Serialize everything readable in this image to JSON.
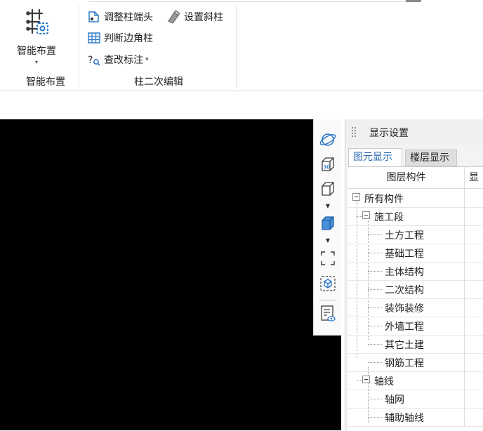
{
  "ribbon": {
    "smart_layout": {
      "label": "智能布置",
      "group_label": "智能布置"
    },
    "column_edit": {
      "adjust_column_end": "调整柱端头",
      "set_inclined_column": "设置斜柱",
      "judge_corner_column": "判断边角柱",
      "check_annotation": "查改标注",
      "group_label": "柱二次编辑"
    }
  },
  "view_toolbar": {
    "icons": [
      "orbit-icon",
      "3d-view-icon",
      "box-view-icon",
      "solid-box-icon",
      "full-screen-icon",
      "isometric-icon",
      "display-settings-icon"
    ]
  },
  "panel": {
    "title": "显示设置",
    "tabs": [
      {
        "label": "图元显示",
        "active": true
      },
      {
        "label": "楼层显示",
        "active": false
      }
    ],
    "columns": {
      "layer": "图层构件",
      "display": "显"
    },
    "rows": [
      {
        "label": "所有构件",
        "level": 0,
        "toggle": true
      },
      {
        "label": "施工段",
        "level": 1,
        "toggle": true
      },
      {
        "label": "土方工程",
        "level": 2,
        "toggle": false
      },
      {
        "label": "基础工程",
        "level": 2,
        "toggle": false
      },
      {
        "label": "主体结构",
        "level": 2,
        "toggle": false
      },
      {
        "label": "二次结构",
        "level": 2,
        "toggle": false
      },
      {
        "label": "装饰装修",
        "level": 2,
        "toggle": false
      },
      {
        "label": "外墙工程",
        "level": 2,
        "toggle": false
      },
      {
        "label": "其它土建",
        "level": 2,
        "toggle": false
      },
      {
        "label": "钢筋工程",
        "level": 2,
        "toggle": false
      },
      {
        "label": "轴线",
        "level": 1,
        "toggle": true
      },
      {
        "label": "轴网",
        "level": 2,
        "toggle": false
      },
      {
        "label": "辅助轴线",
        "level": 2,
        "toggle": false
      }
    ]
  }
}
